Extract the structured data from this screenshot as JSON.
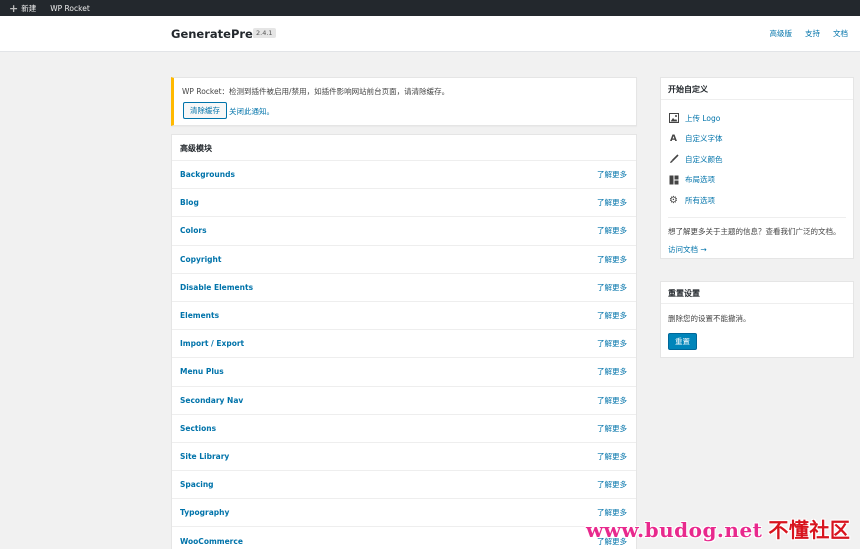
{
  "adminbar": {
    "new_label": "新建",
    "rocket_label": "WP Rocket"
  },
  "header": {
    "title": "GeneratePress",
    "version": "2.4.1",
    "nav": [
      "高级版",
      "支持",
      "文档"
    ]
  },
  "notice": {
    "text": "WP Rocket：检测到插件被启用/禁用，如插件影响网站前台页面，请清除缓存。",
    "button": "清除缓存",
    "dismiss": "关闭此通知。"
  },
  "modules": {
    "heading": "高级模块",
    "more_label": "了解更多",
    "items": [
      "Backgrounds",
      "Blog",
      "Colors",
      "Copyright",
      "Disable Elements",
      "Elements",
      "Import / Export",
      "Menu Plus",
      "Secondary Nav",
      "Sections",
      "Site Library",
      "Spacing",
      "Typography",
      "WooCommerce"
    ]
  },
  "customize": {
    "heading": "开始自定义",
    "items": [
      {
        "icon": "image-icon",
        "label": "上传 Logo"
      },
      {
        "icon": "font-icon",
        "label": "自定义字体"
      },
      {
        "icon": "brush-icon",
        "label": "自定义颜色"
      },
      {
        "icon": "layout-icon",
        "label": "布局选项"
      },
      {
        "icon": "gear-icon",
        "label": "所有选项"
      }
    ],
    "help_text": "想了解更多关于主题的信息？查看我们广泛的文档。",
    "docs_link": "访问文档 →"
  },
  "reset": {
    "heading": "重置设置",
    "text": "删除您的设置不能撤消。",
    "button": "重置"
  },
  "watermark": {
    "url": "www.budog.net",
    "cn": "不懂社区"
  },
  "colors": {
    "accent": "#0073aa",
    "notice_border": "#ffb900",
    "primary_button": "#0085ba",
    "adminbar": "#23282d"
  }
}
